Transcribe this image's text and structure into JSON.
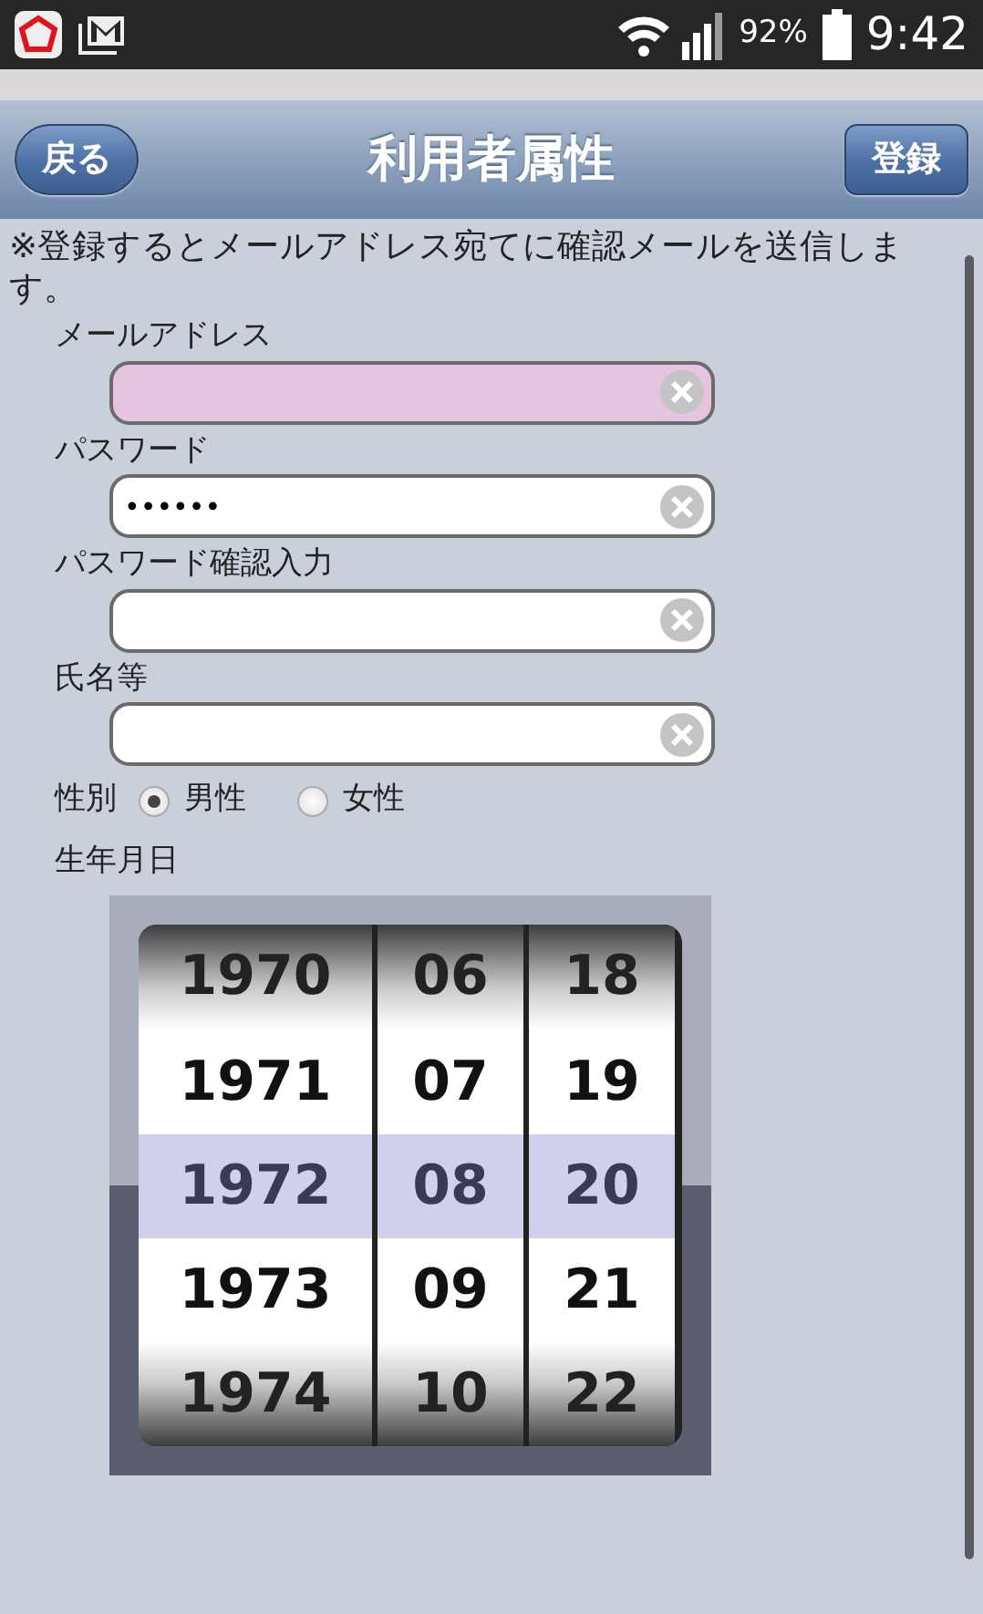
{
  "status_bar": {
    "battery": "92%",
    "time": "9:42"
  },
  "header": {
    "back_button": "戻る",
    "title": "利用者属性",
    "register_button": "登録"
  },
  "notice": "※登録するとメールアドレス宛てに確認メールを送信します。",
  "fields": [
    {
      "label": "メールアドレス",
      "autofilled": true
    },
    {
      "label": "パスワード",
      "value": "••••••",
      "autofilled": false
    },
    {
      "label": "パスワード確認入力",
      "autofilled": false
    },
    {
      "label": "氏名等",
      "autofilled": false
    }
  ],
  "gender": {
    "label": "性別",
    "options": [
      {
        "label": "男性",
        "selected": true
      },
      {
        "label": "女性",
        "selected": false
      }
    ]
  },
  "birthdate": {
    "label": "生年月日",
    "columns": [
      {
        "items": [
          {
            "text": "1970",
            "selected": false
          },
          {
            "text": "1971",
            "selected": false
          },
          {
            "text": "1972",
            "selected": true
          },
          {
            "text": "1973",
            "selected": false
          },
          {
            "text": "1974",
            "selected": false
          }
        ]
      },
      {
        "items": [
          {
            "text": "06",
            "selected": false
          },
          {
            "text": "07",
            "selected": false
          },
          {
            "text": "08",
            "selected": true
          },
          {
            "text": "09",
            "selected": false
          },
          {
            "text": "10",
            "selected": false
          }
        ]
      },
      {
        "items": [
          {
            "text": "18",
            "selected": false
          },
          {
            "text": "19",
            "selected": false
          },
          {
            "text": "20",
            "selected": true
          },
          {
            "text": "21",
            "selected": false
          },
          {
            "text": "22",
            "selected": false
          }
        ]
      }
    ]
  }
}
